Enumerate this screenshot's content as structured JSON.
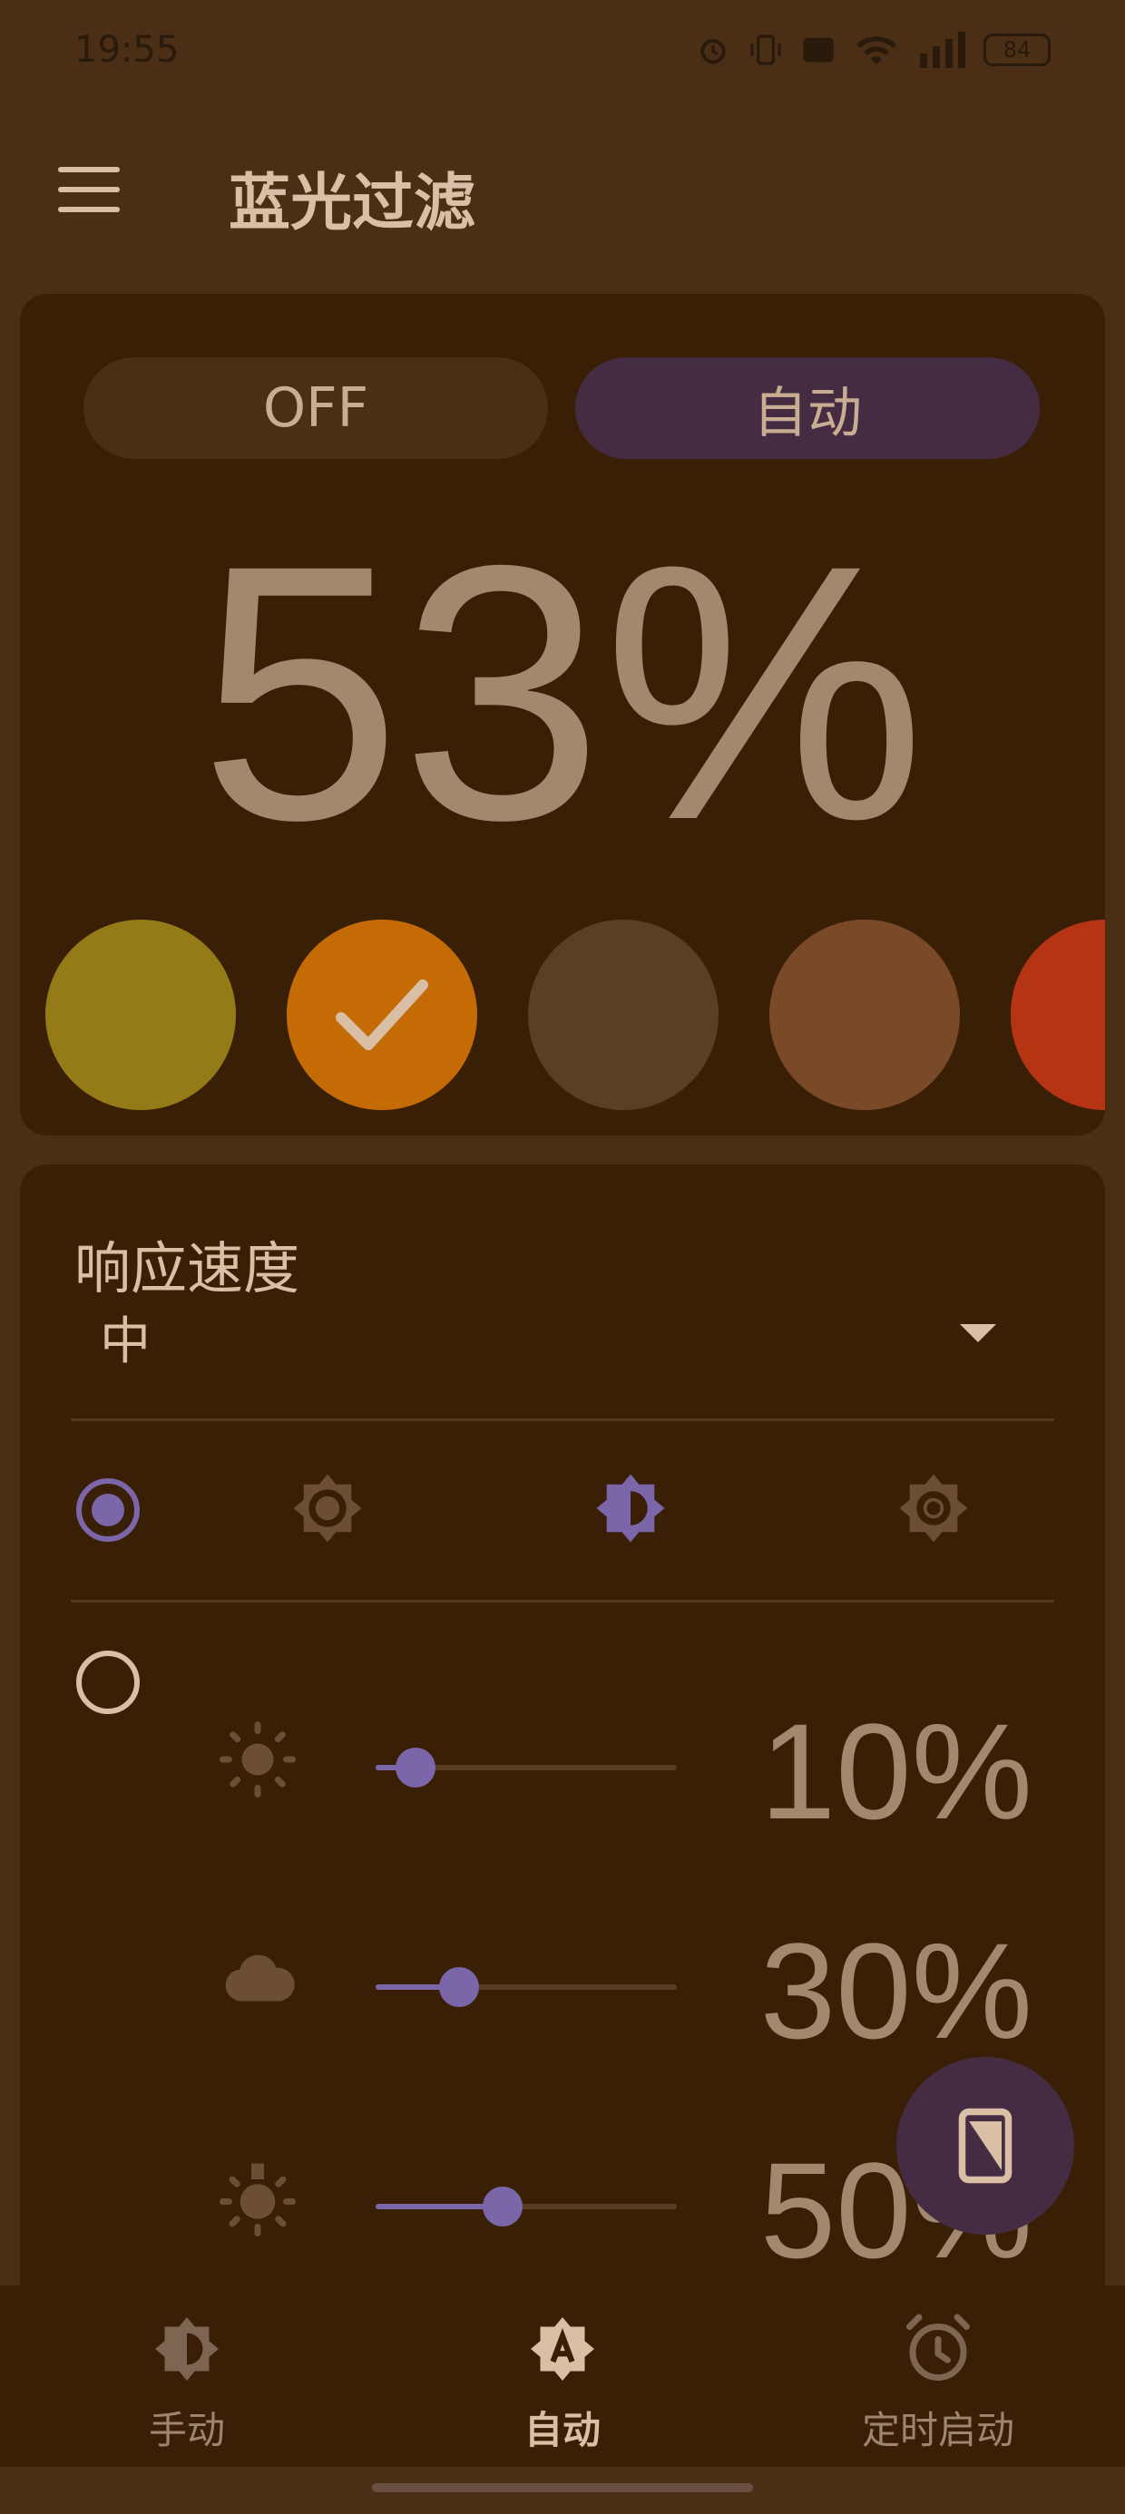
{
  "status_bar": {
    "time": "19:55",
    "battery": "84"
  },
  "app_bar": {
    "title": "蓝光过滤"
  },
  "filter_card": {
    "off_label": "OFF",
    "auto_label": "自动",
    "percentage": "53%",
    "swatches": [
      {
        "color": "#957a18",
        "selected": false
      },
      {
        "color": "#c46b05",
        "selected": true
      },
      {
        "color": "#5b3f23",
        "selected": false
      },
      {
        "color": "#7a4a28",
        "selected": false
      },
      {
        "color": "#b53414",
        "selected": false
      }
    ]
  },
  "settings_card": {
    "response_label": "响应速度",
    "response_value": "中",
    "sliders": [
      {
        "icon": "sun-icon",
        "value": 0.1,
        "label": "10%"
      },
      {
        "icon": "cloud-icon",
        "value": 0.3,
        "label": "30%"
      },
      {
        "icon": "bulb-icon",
        "value": 0.5,
        "label": "50%"
      }
    ]
  },
  "bottom_nav": {
    "items": [
      {
        "label": "手动",
        "icon": "brightness-half-icon",
        "active": false
      },
      {
        "label": "自动",
        "icon": "brightness-auto-icon",
        "active": true
      },
      {
        "label": "定时启动",
        "icon": "alarm-icon",
        "active": false
      }
    ]
  },
  "colors": {
    "accent": "#7a66a8",
    "background": "#4a2e16",
    "card": "#3a1f07"
  }
}
